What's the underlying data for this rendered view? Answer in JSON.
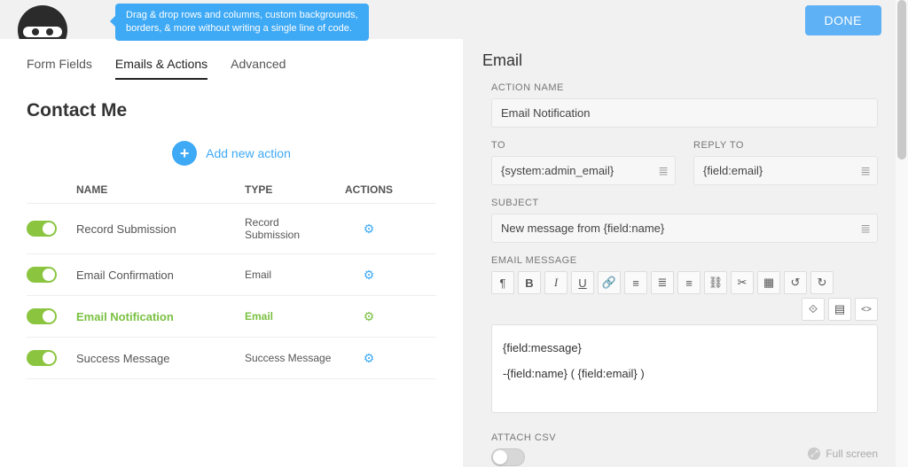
{
  "header": {
    "tooltip_line1": "Drag & drop rows and columns, custom backgrounds,",
    "tooltip_line2": "borders, & more without writing a single line of code.",
    "done": "DONE"
  },
  "tabs": {
    "form_fields": "Form Fields",
    "emails_actions": "Emails & Actions",
    "advanced": "Advanced"
  },
  "page_title": "Contact Me",
  "add_action": {
    "label": "Add new action"
  },
  "table": {
    "col_name": "NAME",
    "col_type": "TYPE",
    "col_actions": "ACTIONS",
    "rows": [
      {
        "name": "Record Submission",
        "type": "Record Submission",
        "selected": false
      },
      {
        "name": "Email Confirmation",
        "type": "Email",
        "selected": false
      },
      {
        "name": "Email Notification",
        "type": "Email",
        "selected": true
      },
      {
        "name": "Success Message",
        "type": "Success Message",
        "selected": false
      }
    ]
  },
  "panel": {
    "title": "Email",
    "action_name_label": "ACTION NAME",
    "action_name_value": "Email Notification",
    "to_label": "TO",
    "to_value": "{system:admin_email}",
    "reply_to_label": "REPLY TO",
    "reply_to_value": "{field:email}",
    "subject_label": "SUBJECT",
    "subject_value": "New message from {field:name}",
    "message_label": "EMAIL MESSAGE",
    "message_line1": "{field:message}",
    "message_line2": "-{field:name} ( {field:email} )",
    "attach_csv_label": "ATTACH CSV"
  },
  "footer": {
    "fullscreen": "Full screen"
  },
  "icons": {
    "paragraph": "¶",
    "bold": "B",
    "italic": "I",
    "underline": "U",
    "link": "🔗",
    "ol": "≡",
    "ul": "≣",
    "align": "≡",
    "chain": "⛓",
    "unlink": "✂",
    "table": "▦",
    "undo": "↺",
    "redo": "↻",
    "embed": "⟐",
    "grid": "▤",
    "code": "</>",
    "list": "≣"
  }
}
